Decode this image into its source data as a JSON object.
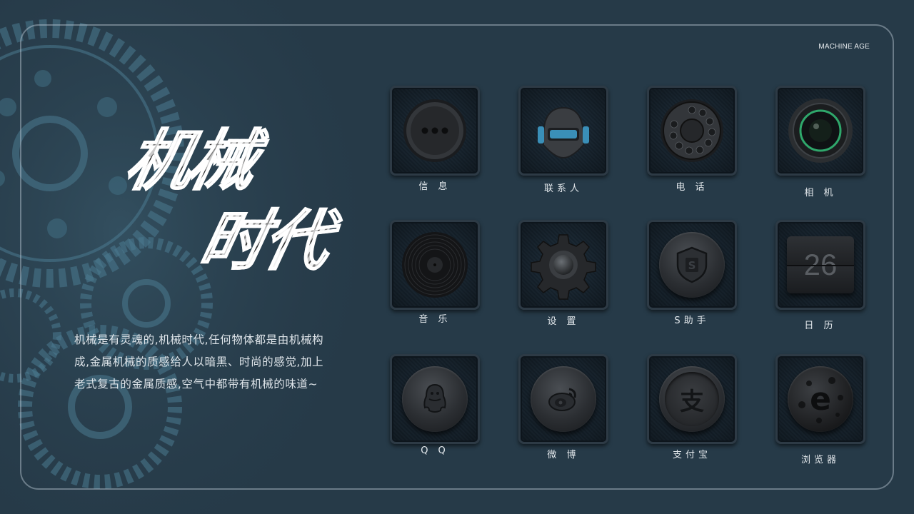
{
  "header": {
    "brand": "MACHINE AGE"
  },
  "hero": {
    "title_line1": "机械",
    "title_line2": "时代",
    "description": [
      "机械是有灵魂的,机械时代,任何物体都是由机械构",
      "成,金属机械的质感给人以暗黑、时尚的感觉,加上",
      "老式复古的金属质感,空气中都带有机械的味道~"
    ]
  },
  "apps": [
    {
      "label": "信 息",
      "icon": "message-icon"
    },
    {
      "label": "联系人",
      "icon": "contacts-helmet-icon"
    },
    {
      "label": "电 话",
      "icon": "rotary-dial-icon"
    },
    {
      "label": "相 机",
      "icon": "camera-lens-icon"
    },
    {
      "label": "音 乐",
      "icon": "vinyl-record-icon"
    },
    {
      "label": "设 置",
      "icon": "gear-icon"
    },
    {
      "label": "S助手",
      "icon": "shield-s-icon"
    },
    {
      "label": "日 历",
      "icon": "calendar-flip-icon",
      "value": "26"
    },
    {
      "label": "Q Q",
      "icon": "qq-penguin-icon"
    },
    {
      "label": "微 博",
      "icon": "weibo-icon"
    },
    {
      "label": "支付宝",
      "icon": "alipay-icon",
      "glyph": "支"
    },
    {
      "label": "浏览器",
      "icon": "browser-e-icon",
      "glyph": "e"
    }
  ],
  "colors": {
    "background": "#263a48",
    "accent_camera": "#2fa76b",
    "accent_helmet": "#3a8fb8"
  }
}
